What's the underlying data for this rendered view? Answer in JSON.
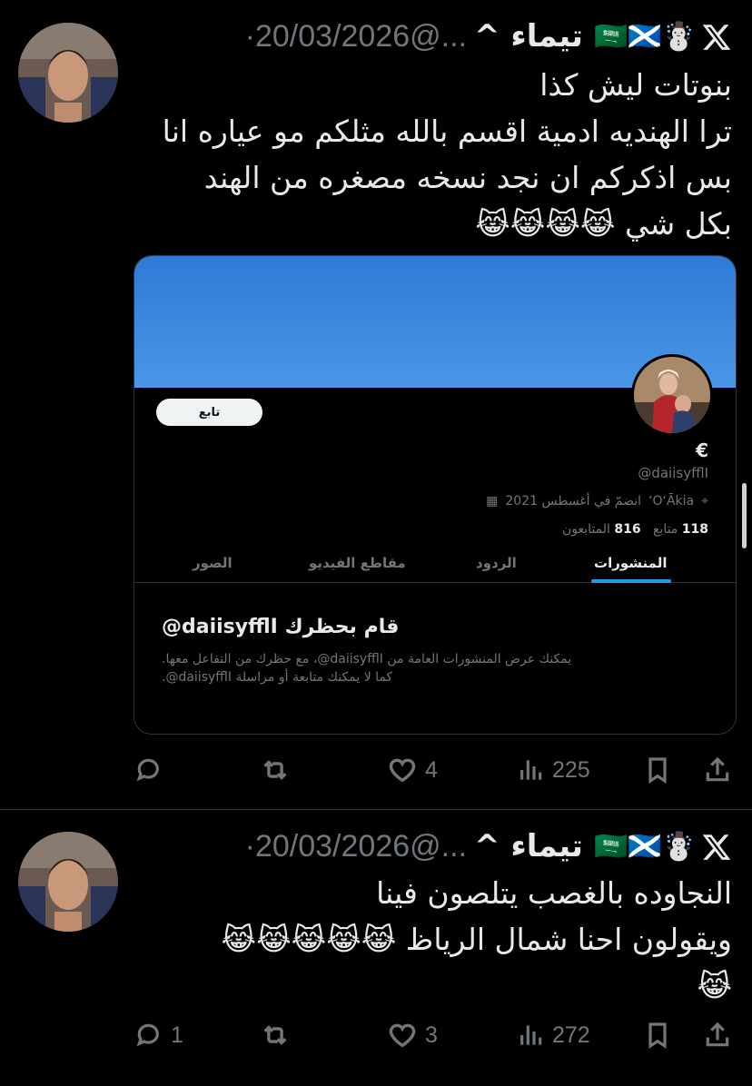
{
  "colors": {
    "background": "#000000",
    "text": "#e7e9ea",
    "muted": "#71767b",
    "accent": "#1d9bf0"
  },
  "tweets": [
    {
      "author_name": "تيماء ^",
      "author_emojis": "🇸🇦🏴󠁧󠁢󠁳󠁣󠁴󠁿☃️",
      "handle": "@...",
      "date": "·20/03/2026",
      "text_lines": [
        "بنوتات ليش كذا",
        "ترا الهنديه ادمية اقسم بالله مثلكم مو عياره انا",
        "بس اذكركم ان نجد نسخه مصغره من الهند",
        "بكل شي 😹😹😹😹"
      ],
      "replies": "",
      "retweets": "",
      "likes": "4",
      "views": "225",
      "embedded_profile": {
        "follow_label": "تابع",
        "display_name": "€",
        "handle": "@daiisyfflI",
        "location": "ʻOʻĀkia",
        "joined": "انضمّ في أغسطس 2021",
        "following_count": "118",
        "following_label": "متابع",
        "followers_count": "816",
        "followers_label": "المتابعون",
        "tabs": [
          "المنشورات",
          "الردود",
          "مقاطع الفيديو",
          "الصور"
        ],
        "blocked_title": "قام بحظرك daiisyfflI@",
        "blocked_body_1": "يمكنك عرض المنشورات العامة من daiisyfflI@، مع حظرك من التفاعل معها.",
        "blocked_body_2": "كما لا يمكنك متابعة أو مراسلة daiisyfflI@."
      }
    },
    {
      "author_name": "تيماء ^",
      "author_emojis": "🇸🇦🏴󠁧󠁢󠁳󠁣󠁴󠁿☃️",
      "handle": "@...",
      "date": "·20/03/2026",
      "text_lines": [
        "النجاوده بالغصب يتلصون فينا",
        "ويقولون احنا شمال الرياظ 😹😹😹😹😹",
        "😹"
      ],
      "replies": "1",
      "retweets": "",
      "likes": "3",
      "views": "272"
    }
  ]
}
